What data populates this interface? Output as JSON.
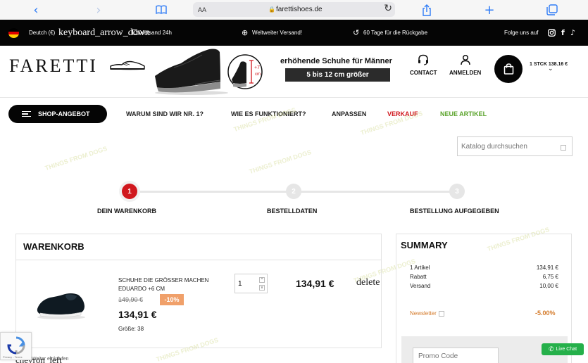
{
  "browser": {
    "url_host": "farettishoes.de",
    "text_size_label": "AA",
    "icons": {
      "back": "chevron-left-icon",
      "forward": "chevron-right-icon",
      "bookmarks": "book-icon",
      "lock": "lock-icon",
      "reload": "reload-icon",
      "share": "share-icon",
      "new_tab": "plus-icon",
      "tabs": "tabs-icon"
    },
    "accent_color": "#2f7cf6"
  },
  "topbar": {
    "language": "Deutch (€)",
    "language_arrow_text": "keyboard_arrow_down",
    "shipping_24": "Versand 24h",
    "worldwide": "Weltweiter Versand!",
    "returns": "60 Tage für die Rückgabe",
    "follow": "Folge uns auf"
  },
  "header": {
    "logo": "FARETTI",
    "banner_title": "erhöhende Schuhe für Männer",
    "banner_sub": "5 bis 12 cm größer",
    "banner_height_label": "+7",
    "banner_height_unit": "cm",
    "contact": "CONTACT",
    "login": "ANMELDEN",
    "cart_summary": "1 STCK 138.16 €"
  },
  "nav": {
    "shop": "SHOP-ANGEBOT",
    "items": [
      "WARUM SIND WIR NR. 1?",
      "WIE ES FUNKTIONIERT?",
      "ANPASSEN",
      "VERKAUF",
      "NEUE ARTIKEL"
    ],
    "sale_color": "#d0181e",
    "new_color": "#5aa32a"
  },
  "search": {
    "placeholder": "Katalog durchsuchen"
  },
  "steps": [
    {
      "number": "1",
      "label": "DEIN WARENKORB"
    },
    {
      "number": "2",
      "label": "BESTELLDATEN"
    },
    {
      "number": "3",
      "label": "BESTELLUNG AUFGEGEBEN"
    }
  ],
  "cart": {
    "title": "WARENKORB",
    "item": {
      "name": "SCHUHE DIE GRÖSSER MACHEN EDUARDO +6 CM",
      "old_price": "149,90 €",
      "discount": "-10%",
      "price": "134,91 €",
      "size_label": "Größe:",
      "size": "38",
      "quantity": "1",
      "line_total": "134,91 €",
      "delete_label": "delete"
    },
    "below_text": "chevron_left",
    "below_small": "Weiter einkaufen"
  },
  "summary": {
    "title": "SUMMARY",
    "rows": [
      {
        "label": "1 Artikel",
        "value": "134,91 €"
      },
      {
        "label": "Rabatt",
        "value": "6,75 €"
      },
      {
        "label": "Versand",
        "value": "10,00 €"
      }
    ],
    "newsletter": "Newsletter",
    "newsletter_discount": "-5.00%",
    "promo_placeholder": "Promo Code"
  },
  "live_chat": "Live Chat",
  "recaptcha": "Privacy - Terms",
  "watermark": "THINGS FROM DOGS"
}
